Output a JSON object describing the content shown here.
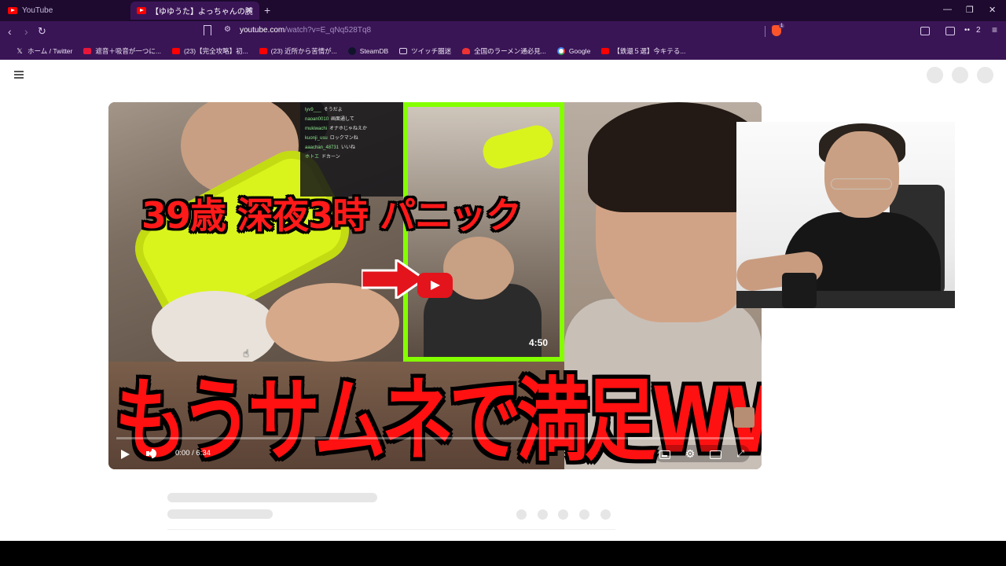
{
  "browser": {
    "tabs": [
      {
        "title": "YouTube",
        "active": false
      },
      {
        "title": "【ゆゆうた】よっちゃんの腕が抜けなくな",
        "active": true
      }
    ],
    "new_tab_glyph": "+",
    "close_glyph": "✕",
    "window_controls": [
      "—",
      "❐",
      "✕"
    ],
    "url_host": "youtube.com",
    "url_rest": "/watch?v=E_qNq528Tq8",
    "shield_count": "1",
    "wallet_count": "2",
    "bookmarks": [
      {
        "label": "ホーム / Twitter",
        "icon": "x-icon"
      },
      {
        "label": "遮音＋吸音が一つに...",
        "icon": "red-icon"
      },
      {
        "label": "(23)【完全攻略】初...",
        "icon": "youtube-icon"
      },
      {
        "label": "(23) 近所から苦情が...",
        "icon": "youtube-icon"
      },
      {
        "label": "SteamDB",
        "icon": "steam-icon"
      },
      {
        "label": "ツイッチ圏迷",
        "icon": "folder-icon"
      },
      {
        "label": "全国のラーメン通必見...",
        "icon": "ramen-icon"
      },
      {
        "label": "Google",
        "icon": "google-icon"
      },
      {
        "label": "【鉄還５選】今キテる...",
        "icon": "youtube-icon"
      }
    ]
  },
  "video": {
    "thumbnail_top_text": "39歳 深夜3時 パニック",
    "thumbnail_bottom_text": "もうサムネで満足WWW",
    "thumbnail_duration": "4:50",
    "time_display": "0:00 / 6:34",
    "progress": 0,
    "chat": [
      {
        "user": "lyv9___",
        "msg": "そうだよ"
      },
      {
        "user": "naoan0010",
        "msg": "画面通して"
      },
      {
        "user": "mukiwachi",
        "msg": "オナホじゃねえか"
      },
      {
        "user": "kuonji_usu",
        "msg": "ロックマンね"
      },
      {
        "user": "aaachan_48731",
        "msg": "いいね"
      },
      {
        "user": "ホトエ",
        "msg": "ドカーン"
      }
    ]
  },
  "colors": {
    "brand_red": "#ff0000",
    "chrome_dark": "#1d0a2e",
    "chrome_toolbar": "#3a1556",
    "neon_green": "#84ff00",
    "roller_yellow": "#d9f41c"
  }
}
